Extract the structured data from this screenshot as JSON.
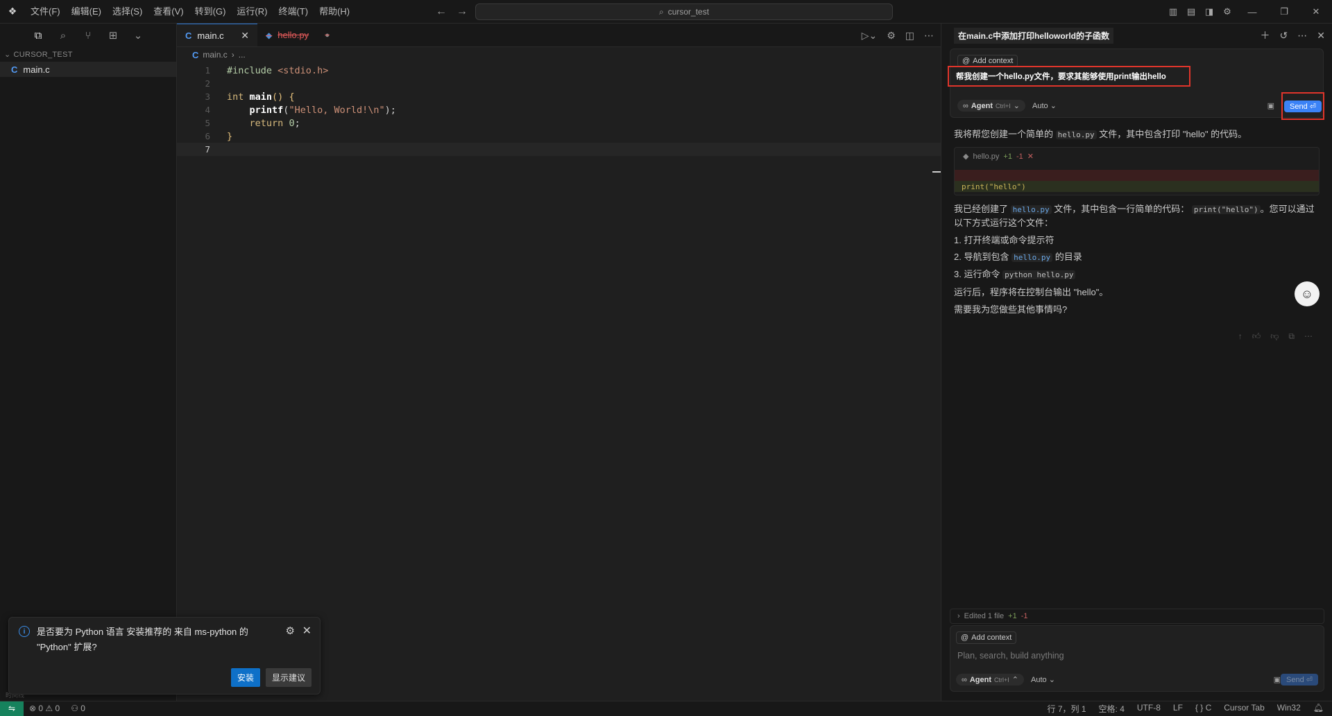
{
  "titlebar": {
    "menu": [
      "文件(F)",
      "编辑(E)",
      "选择(S)",
      "查看(V)",
      "转到(G)",
      "运行(R)",
      "终端(T)",
      "帮助(H)"
    ],
    "search_text": "cursor_test",
    "icons": [
      "toggle-primary-sidebar-icon",
      "toggle-panel-icon",
      "toggle-secondary-sidebar-icon",
      "settings-icon"
    ]
  },
  "sidebar": {
    "explorer_title": "CURSOR_TEST",
    "files": [
      {
        "name": "main.c",
        "icon": "c-file-icon"
      }
    ],
    "outline_label": "时间线"
  },
  "editor": {
    "tabs": [
      {
        "label": "main.c",
        "active": true,
        "icon": "c-file-icon"
      },
      {
        "label": "hello.py",
        "active": false,
        "deleted": true,
        "icon": "python-file-icon"
      }
    ],
    "breadcrumb": {
      "file": "main.c",
      "rest": "..."
    },
    "line_numbers": [
      "1",
      "2",
      "3",
      "4",
      "5",
      "6",
      "7"
    ],
    "current_line": 7
  },
  "chat": {
    "title": "在main.c中添加打印helloworld的子函数",
    "add_context": "Add context",
    "user_message": "帮我创建一个hello.py文件，要求其能够使用print输出hello",
    "agent_label": "Agent",
    "agent_shortcut": "Ctrl+I",
    "mode": "Auto",
    "send_label": "Send",
    "send_shortcut": "⏎",
    "intro_before": "我将帮您创建一个简单的",
    "intro_code": "hello.py",
    "intro_after": "文件，其中包含打印 \"hello\" 的代码。",
    "diff": {
      "file": "hello.py",
      "added": "+1",
      "removed": "-1",
      "marker": "✕",
      "code": "print(\"hello\")"
    },
    "done_before": "我已经创建了",
    "done_code1": "hello.py",
    "done_mid": "文件，其中包含一行简单的代码：",
    "done_code2": "print(\"hello\")",
    "done_after": "。您可以通过以下方式运行这个文件：",
    "steps": [
      {
        "num": "1.",
        "text": "打开终端或命令提示符",
        "code": ""
      },
      {
        "num": "2.",
        "text": "导航到包含",
        "code": "hello.py",
        "tail": "的目录"
      },
      {
        "num": "3.",
        "text": "运行命令",
        "code": "python hello.py",
        "tail": ""
      }
    ],
    "after_run": "运行后，程序将在控制台输出 \"hello\"。",
    "followup": "需要我为您做些其他事情吗?",
    "edited_bar": {
      "label": "Edited 1 file",
      "added": "+1",
      "removed": "-1"
    },
    "placeholder": "Plan, search, build anything"
  },
  "notification": {
    "message": "是否要为 Python 语言 安装推荐的 来自 ms-python 的 \"Python\" 扩展?",
    "install": "安装",
    "show_suggestions": "显示建议"
  },
  "statusbar": {
    "errors": "0",
    "warnings": "0",
    "ports": "0",
    "position": "行 7，列 1",
    "spaces": "空格: 4",
    "encoding": "UTF-8",
    "eol": "LF",
    "language": "C",
    "cursor_tab": "Cursor Tab",
    "platform": "Win32"
  }
}
